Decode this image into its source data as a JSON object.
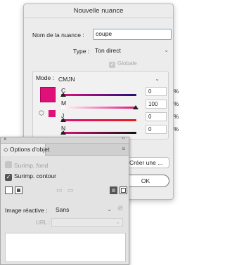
{
  "dialog": {
    "title": "Nouvelle nuance",
    "name_label": "Nom de la nuance :",
    "name_value": "coupe",
    "type_label": "Type :",
    "type_value": "Ton direct",
    "global_label": "Globale",
    "mode_label": "Mode :",
    "mode_value": "CMJN",
    "swatch_color": "#e0107a",
    "channels": [
      {
        "label": "C",
        "value": "0",
        "unit": "%",
        "level": 0,
        "track": "linear-gradient(to right,#e0107a,#20107a)"
      },
      {
        "label": "M",
        "value": "100",
        "unit": "%",
        "level": 100,
        "track": "linear-gradient(to right,#ffffff,#e0107a)"
      },
      {
        "label": "J",
        "value": "0",
        "unit": "%",
        "level": 0,
        "track": "linear-gradient(to right,#e0107a,#e02020)"
      },
      {
        "label": "N",
        "value": "0",
        "unit": "%",
        "level": 0,
        "track": "linear-gradient(to right,#e0107a,#101010)"
      }
    ],
    "create_button": "Créer une ...",
    "ok_button": "OK"
  },
  "panel": {
    "close_glyph": "×",
    "collapse_glyph": "‹‹",
    "tab_label": "◇ Options d'objet",
    "menu_glyph": "≡",
    "fill_label": "Surimp. fond",
    "stroke_label": "Surimp. contour",
    "reactive_label": "Image réactive :",
    "reactive_value": "Sans",
    "url_label": "URL :"
  }
}
